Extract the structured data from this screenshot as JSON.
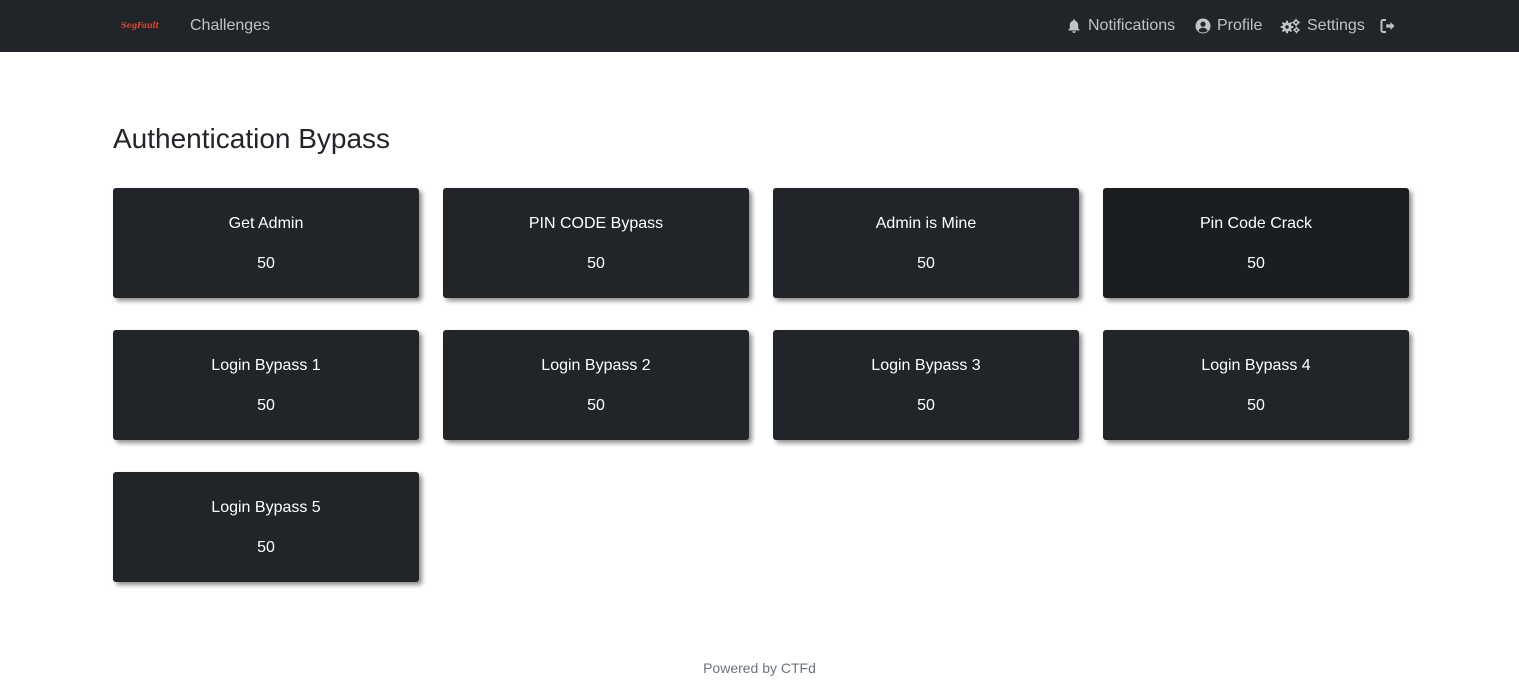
{
  "navbar": {
    "brand_text": "SegFault",
    "brand_color": "#d6452b",
    "left_links": [
      {
        "label": "Challenges"
      }
    ],
    "right_links": [
      {
        "label": "Notifications",
        "icon": "bell-icon"
      },
      {
        "label": "Profile",
        "icon": "user-circle-icon"
      },
      {
        "label": "Settings",
        "icon": "gears-icon"
      },
      {
        "label": "",
        "icon": "logout-icon"
      }
    ]
  },
  "category": {
    "title": "Authentication Bypass"
  },
  "challenges": [
    {
      "name": "Get Admin",
      "value": "50"
    },
    {
      "name": "PIN CODE Bypass",
      "value": "50"
    },
    {
      "name": "Admin is Mine",
      "value": "50"
    },
    {
      "name": "Pin Code Crack",
      "value": "50"
    },
    {
      "name": "Login Bypass 1",
      "value": "50"
    },
    {
      "name": "Login Bypass 2",
      "value": "50"
    },
    {
      "name": "Login Bypass 3",
      "value": "50"
    },
    {
      "name": "Login Bypass 4",
      "value": "50"
    },
    {
      "name": "Login Bypass 5",
      "value": "50"
    }
  ],
  "footer": {
    "text": "Powered by CTFd"
  },
  "colors": {
    "navbar_bg": "#212529",
    "card_bg": "#212529",
    "card_bg_hover": "#1b1e21",
    "nav_text": "#bfc3c8",
    "footer_text": "#6c757d"
  }
}
